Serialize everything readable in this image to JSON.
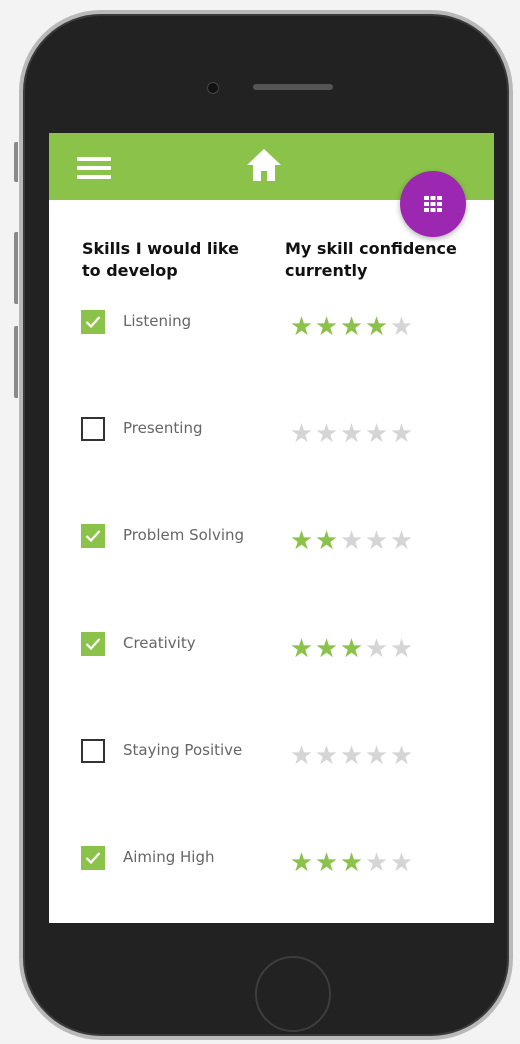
{
  "header": {
    "menu_icon": "hamburger-icon",
    "home_icon": "home-icon",
    "fab_icon": "grid-icon",
    "bar_color": "#8bc34a",
    "fab_color": "#9c27b0"
  },
  "columns": {
    "skills_heading": "Skills I would like to develop",
    "confidence_heading": "My skill confidence currently"
  },
  "colors": {
    "star_on": "#8bc34a",
    "star_off": "#d5d5d5",
    "check_on": "#8bc34a"
  },
  "skills": [
    {
      "label": "Listening",
      "checked": true,
      "rating": 4,
      "max": 5
    },
    {
      "label": "Presenting",
      "checked": false,
      "rating": 0,
      "max": 5
    },
    {
      "label": "Problem Solving",
      "checked": true,
      "rating": 2,
      "max": 5
    },
    {
      "label": "Creativity",
      "checked": true,
      "rating": 3,
      "max": 5
    },
    {
      "label": "Staying Positive",
      "checked": false,
      "rating": 0,
      "max": 5
    },
    {
      "label": "Aiming High",
      "checked": true,
      "rating": 3,
      "max": 5
    }
  ]
}
